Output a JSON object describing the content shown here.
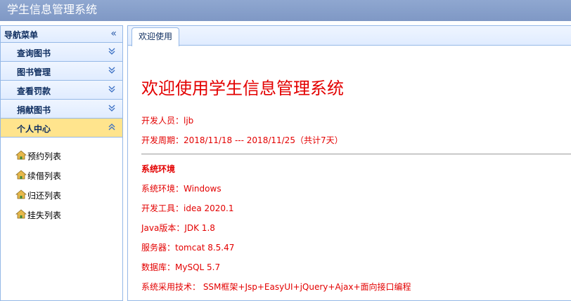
{
  "app": {
    "title": "学生信息管理系统"
  },
  "sidebar": {
    "title": "导航菜单",
    "collapse_icon": "double-chevron-left-icon",
    "sections": [
      {
        "label": "查询图书",
        "expanded": false
      },
      {
        "label": "图书管理",
        "expanded": false
      },
      {
        "label": "查看罚款",
        "expanded": false
      },
      {
        "label": "捐献图书",
        "expanded": false
      },
      {
        "label": "个人中心",
        "expanded": true
      }
    ],
    "links": [
      {
        "label": "预约列表",
        "icon": "house-icon"
      },
      {
        "label": "续借列表",
        "icon": "house-icon"
      },
      {
        "label": "归还列表",
        "icon": "house-icon"
      },
      {
        "label": "挂失列表",
        "icon": "house-icon"
      }
    ]
  },
  "tabs": [
    {
      "label": "欢迎使用",
      "active": true
    }
  ],
  "welcome": {
    "heading": "欢迎使用学生信息管理系统",
    "developer": "开发人员：ljb",
    "period": "开发周期：2018/11/18 --- 2018/11/25（共计7天）",
    "env_heading": "系统环境",
    "env": [
      "系统环境：Windows",
      "开发工具：idea 2020.1",
      "Java版本：JDK 1.8",
      "服务器：tomcat 8.5.47",
      "数据库：MySQL 5.7",
      "系统采用技术： SSM框架+Jsp+EasyUI+jQuery+Ajax+面向接口编程"
    ]
  },
  "colors": {
    "header_bg": "#8fa7d0",
    "border": "#95b8e7",
    "active_section": "#ffe48d",
    "text_accent": "#e30000"
  }
}
